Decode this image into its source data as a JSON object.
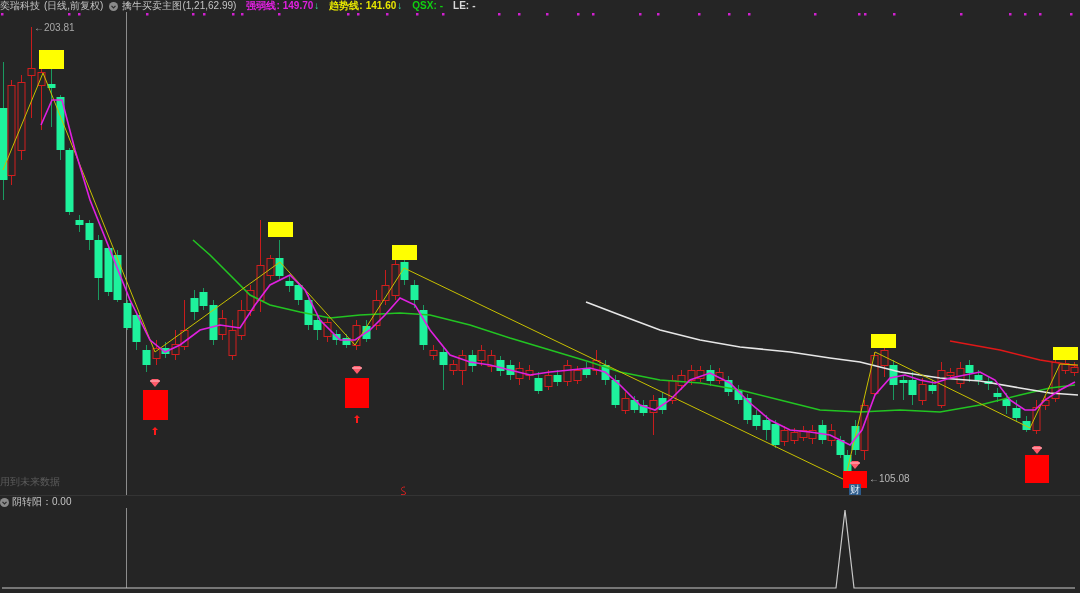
{
  "header": {
    "stock_name": "奕瑞科技",
    "period": "(日线,前复权)",
    "indicator": "擒牛买卖主图(1,21,62.99)",
    "readings": [
      {
        "label": "强弱线:",
        "value": "149.70",
        "arrow": "↓",
        "color": "#e020e0"
      },
      {
        "label": "趋势线:",
        "value": "141.60",
        "arrow": "↓",
        "color": "#e6e600"
      },
      {
        "label": "QSX:",
        "value": "-",
        "color": "#10d010"
      },
      {
        "label": "LE:",
        "value": "-",
        "color": "#d8d8d8"
      }
    ]
  },
  "main_chart": {
    "high_label": "←203.81",
    "low_label": "←105.08",
    "future_data_note": "用到未来数据",
    "finance_badge": "财"
  },
  "sub_chart": {
    "title": "阴转阳：0.00"
  }
}
